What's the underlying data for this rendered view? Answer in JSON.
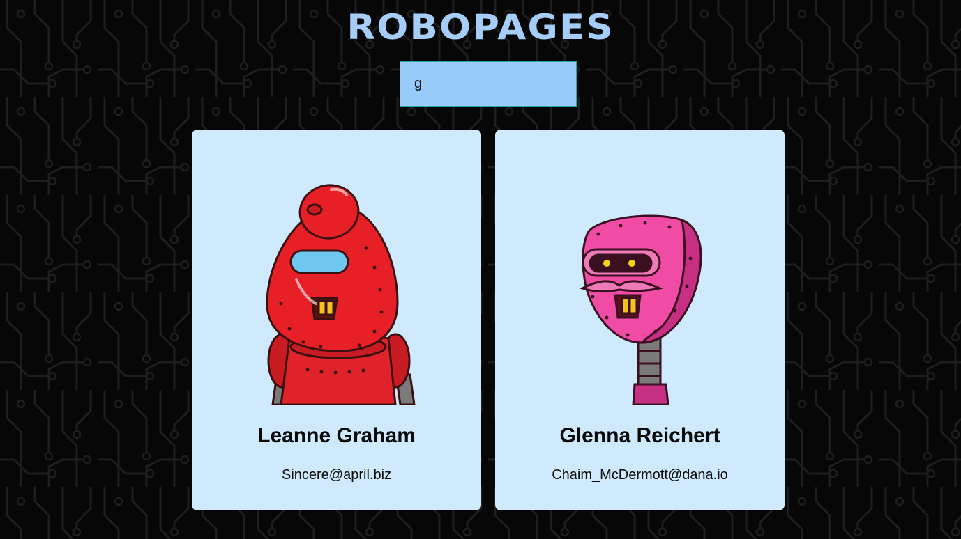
{
  "header": {
    "title": "ROBOPAGES"
  },
  "search": {
    "value": "g"
  },
  "cards": [
    {
      "name": "Leanne Graham",
      "email": "Sincere@april.biz",
      "robot_color": "#e71f26"
    },
    {
      "name": "Glenna Reichert",
      "email": "Chaim_McDermott@dana.io",
      "robot_color": "#f04ca5"
    }
  ],
  "colors": {
    "background": "#070707",
    "title": "#a6cdf7",
    "search_bg": "#96cbfa",
    "search_border": "#25a6a0",
    "card_bg": "#cfeafd"
  }
}
